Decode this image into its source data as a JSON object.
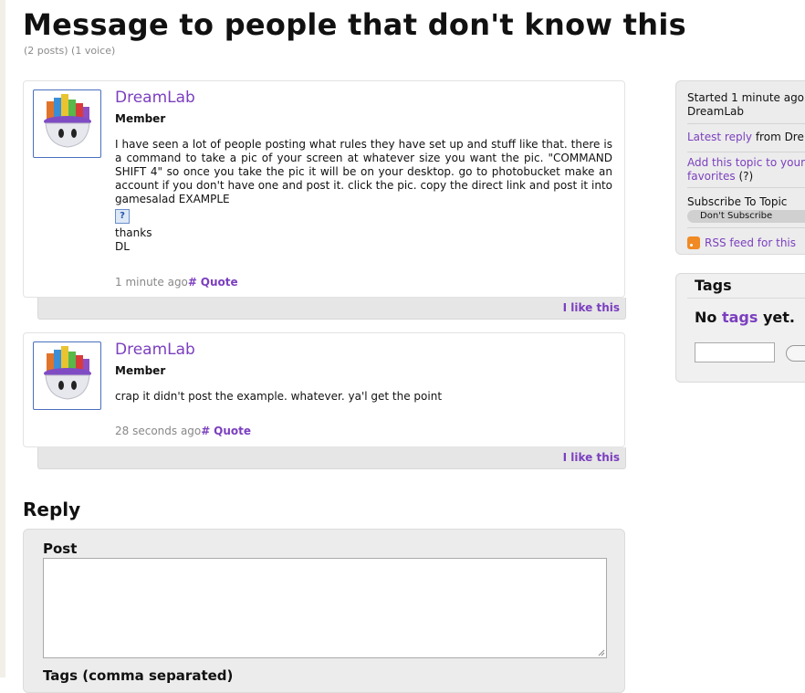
{
  "topic": {
    "title": "Message to people that don't know this",
    "meta": "(2 posts) (1 voice)"
  },
  "posts": [
    {
      "author": "DreamLab",
      "role": "Member",
      "body_lines": "I have seen a lot of people posting what rules they have set up and stuff like that. there is a command to take a pic of your screen at whatever size you want the pic. \"COMMAND SHIFT 4\" so once you take the pic it will be on your desktop. go to photobucket make an account if you don't have one and post it. click the pic. copy the direct link and post it into gamesalad EXAMPLE",
      "image_placeholder": "?",
      "closing_1": "thanks",
      "closing_2": "DL",
      "time": "1 minute ago",
      "permalink": "#",
      "quote": "Quote",
      "like": "I like this"
    },
    {
      "author": "DreamLab",
      "role": "Member",
      "body": "crap it didn't post the example. whatever. ya'l get the point",
      "time": "28 seconds ago",
      "permalink": "#",
      "quote": "Quote",
      "like": "I like this"
    }
  ],
  "reply": {
    "heading": "Reply",
    "post_label": "Post",
    "tags_label": "Tags (comma separated)"
  },
  "sidebar": {
    "started_line1": "Started 1 minute ago",
    "started_line2": "DreamLab",
    "latest_reply_link": "Latest reply",
    "latest_reply_rest": " from Dre",
    "favorites_line1": "Add this topic to your",
    "favorites_line2": "favorites",
    "favorites_help": " (?)",
    "subscribe_label": "Subscribe To Topic",
    "subscribe_option": "Don't Subscribe",
    "rss_label": "RSS feed for this"
  },
  "tags_panel": {
    "heading": "Tags",
    "no_tags_prefix": "No ",
    "no_tags_link": "tags",
    "no_tags_suffix": " yet."
  },
  "icons": {
    "avatar": "gamesalad-bowl-icon",
    "rss": "rss-icon",
    "broken_image": "broken-image-icon"
  },
  "colors": {
    "link": "#7b3fbf",
    "rss": "#f08a24"
  }
}
